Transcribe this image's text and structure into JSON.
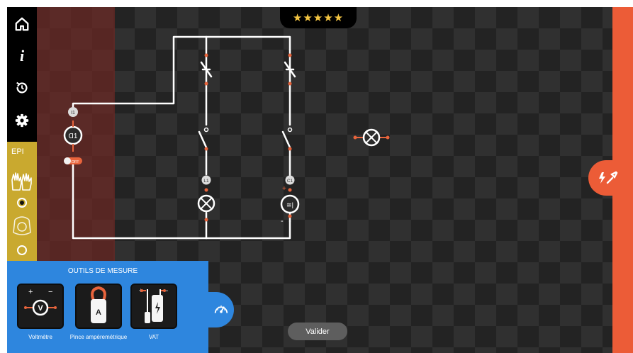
{
  "rating": {
    "stars": "★★★★★",
    "count": 5
  },
  "sidebar": {
    "items": [
      {
        "name": "home-icon"
      },
      {
        "name": "info-icon",
        "label": "i"
      },
      {
        "name": "history-icon"
      },
      {
        "name": "settings-icon"
      }
    ]
  },
  "epi": {
    "label": "EPI",
    "items": [
      {
        "name": "gloves-icon",
        "selected": true
      },
      {
        "name": "face-shield-icon",
        "selected": false
      }
    ]
  },
  "tools": {
    "title": "OUTILS DE MESURE",
    "items": [
      {
        "label": "Voltmètre",
        "icon": "voltmeter-icon",
        "symbol": "V",
        "plus": "+",
        "minus": "−"
      },
      {
        "label": "Pince ampèremétrique",
        "icon": "clamp-meter-icon",
        "symbol": "A"
      },
      {
        "label": "VAT",
        "icon": "vat-tester-icon",
        "plus": "+",
        "minus": "−"
      }
    ]
  },
  "circuit": {
    "component_labels": {
      "left_device_tag": "I1",
      "left_device": "Ɑ1",
      "lamp_tag": "L1",
      "charger_tag": "C1",
      "charger_symbol": "≅|",
      "plus": "+",
      "minus": "-"
    },
    "toggle_state": "OFF"
  },
  "actions": {
    "validate": "Valider"
  },
  "colors": {
    "accent_orange": "#ec5c37",
    "tools_blue": "#2e86de",
    "epi_gold": "#c9a92f",
    "wire": "#ffffff",
    "terminal": "#e8643c"
  }
}
